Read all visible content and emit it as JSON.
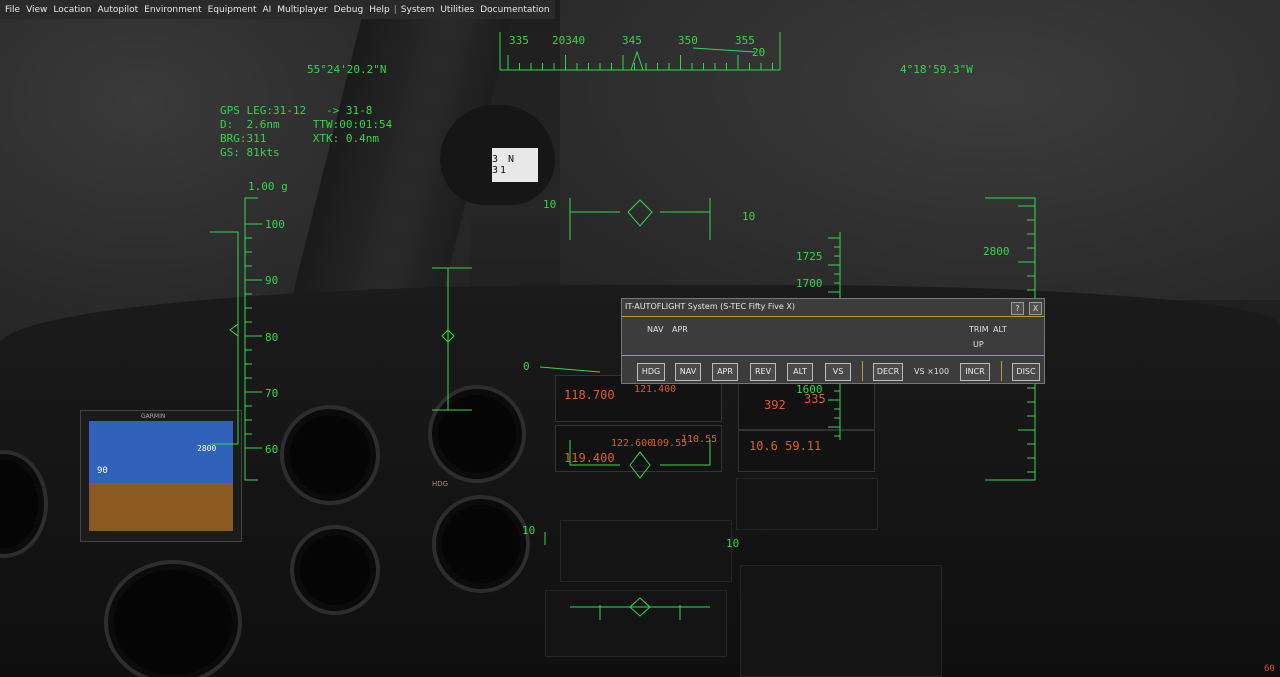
{
  "menu": {
    "items": [
      "File",
      "View",
      "Location",
      "Autopilot",
      "Environment",
      "Equipment",
      "AI",
      "Multiplayer",
      "Debug",
      "Help"
    ],
    "separator": "|",
    "items2": [
      "System",
      "Utilities",
      "Documentation"
    ]
  },
  "hud": {
    "latitude": "55°24'20.2\"N",
    "longitude": "4°18'59.3\"W",
    "gps_line1": "GPS LEG:31-12   -> 31-8",
    "gps_line2": "D:  2.6nm     TTW:00:01:54",
    "gps_line3": "BRG:311       XTK: 0.4nm",
    "gps_line4": "GS: 81kts",
    "g_load": "1.00 g",
    "heading_ticks": [
      "335",
      "20340",
      "345",
      "350",
      "355"
    ],
    "heading_sub": "20",
    "speed_ticks": [
      "100",
      "90",
      "80",
      "70",
      "60"
    ],
    "alt_ticks": [
      "1725",
      "1700",
      "1600"
    ],
    "alt_right": "2800",
    "pitch_upper_left": "10",
    "pitch_upper_right": "10",
    "pitch_lower_left": "10",
    "pitch_lower_right": "10",
    "horizon_label": "0",
    "color": "#33d64a"
  },
  "panel": {
    "compass_card": "3 N 31",
    "com1_active": "118.700",
    "com1_standby": "121.400",
    "nav_active": "119.400",
    "nav_standby1": "122.600",
    "nav_standby2": "109.55",
    "nav_standby3": "110.55",
    "alt_preselect": "392",
    "alt_preselect2": "335",
    "timer": "10.6  59.11",
    "pfd_brand": "GARMIN",
    "pfd_speed": "90",
    "pfd_alt": "2800",
    "adf_label": "HDG"
  },
  "autopilot": {
    "title": "IT-AUTOFLIGHT System (S-TEC Fifty Five X)",
    "help_button": "?",
    "close_button": "X",
    "annun_nav": "NAV",
    "annun_apr": "APR",
    "annun_trim": "TRIM",
    "annun_alt": "ALT",
    "annun_up": "UP",
    "buttons": [
      "HDG",
      "NAV",
      "APR",
      "REV",
      "ALT",
      "VS"
    ],
    "decr": "DECR",
    "vs_label": "VS ×100",
    "incr": "INCR",
    "disc": "DISC",
    "accent": "#b8963a"
  },
  "fps": "60"
}
